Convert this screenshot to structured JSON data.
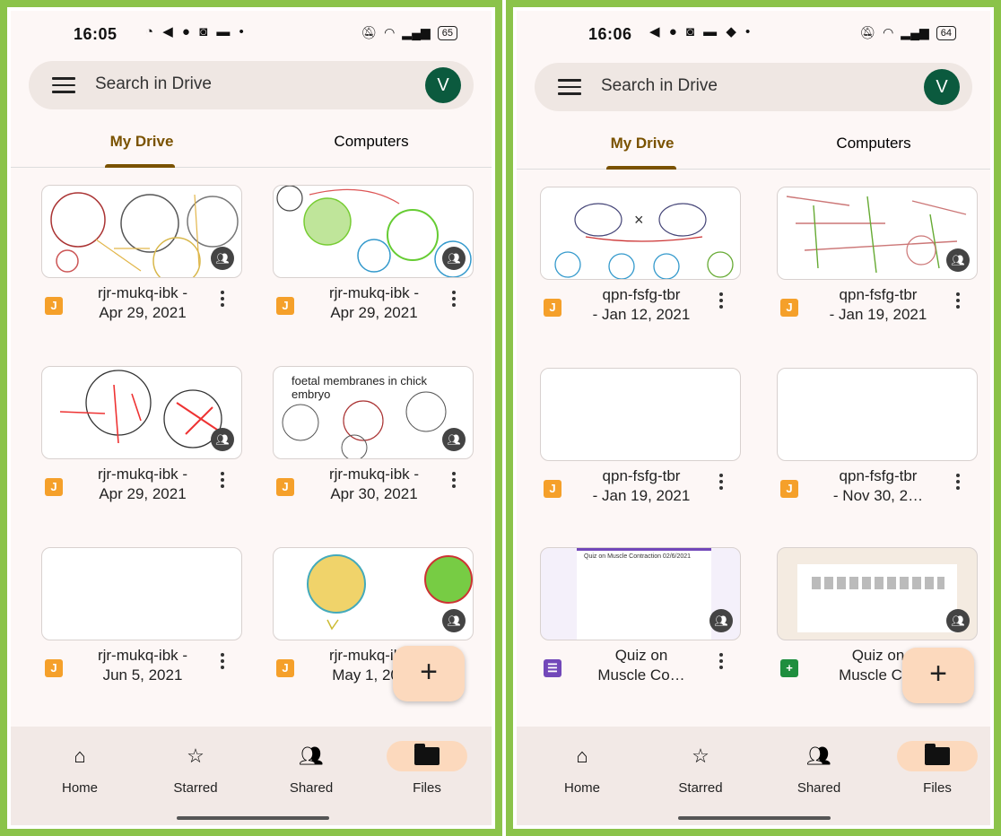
{
  "colors": {
    "accent": "#7a5200",
    "border": "#8bc34a",
    "avatar": "#0b5a3e",
    "fab": "#fcd9bd",
    "jamboard": "#f5a02a",
    "forms": "#7248b9",
    "sheets": "#1e8e3e"
  },
  "left": {
    "status": {
      "time": "16:05",
      "notifications": "◔ ◀ ● ◙ ▬ •",
      "battery": "65"
    },
    "search": {
      "placeholder": "Search in Drive",
      "avatar": "V"
    },
    "tabs": [
      "My Drive",
      "Computers"
    ],
    "files": [
      {
        "line1": "rjr-mukq-ibk -",
        "line2": "Apr 29, 2021",
        "icon": "jamboard-icon"
      },
      {
        "line1": "rjr-mukq-ibk -",
        "line2": "Apr 29, 2021",
        "icon": "jamboard-icon"
      },
      {
        "line1": "rjr-mukq-ibk -",
        "line2": "Apr 29, 2021",
        "icon": "jamboard-icon"
      },
      {
        "line1": "rjr-mukq-ibk -",
        "line2": "Apr 30, 2021",
        "icon": "jamboard-icon",
        "thumb_text": "foetal membranes in chick embryo"
      },
      {
        "line1": "rjr-mukq-ibk -",
        "line2": "Jun 5, 2021",
        "icon": "jamboard-icon"
      },
      {
        "line1": "rjr-mukq-ibk -",
        "line2": "May 1, 2021",
        "icon": "jamboard-icon"
      }
    ],
    "nav": [
      "Home",
      "Starred",
      "Shared",
      "Files"
    ]
  },
  "right": {
    "status": {
      "time": "16:06",
      "notifications": "◀ ● ◙ ▬ ◆ •",
      "battery": "64"
    },
    "search": {
      "placeholder": "Search in Drive",
      "avatar": "V"
    },
    "tabs": [
      "My Drive",
      "Computers"
    ],
    "files": [
      {
        "line1": "qpn-fsfg-tbr",
        "line2": "- Jan 12, 2021",
        "icon": "jamboard-icon"
      },
      {
        "line1": "qpn-fsfg-tbr",
        "line2": "- Jan 19, 2021",
        "icon": "jamboard-icon"
      },
      {
        "line1": "qpn-fsfg-tbr",
        "line2": "- Jan 19, 2021",
        "icon": "jamboard-icon"
      },
      {
        "line1": "qpn-fsfg-tbr",
        "line2": "- Nov 30, 2…",
        "icon": "jamboard-icon"
      },
      {
        "line1": "Quiz on",
        "line2": "Muscle Co…",
        "icon": "forms-icon",
        "thumb_text": "Quiz on Muscle Contraction 02/6/2021"
      },
      {
        "line1": "Quiz on",
        "line2": "Muscle C…",
        "icon": "sheets-icon"
      }
    ],
    "nav": [
      "Home",
      "Starred",
      "Shared",
      "Files"
    ]
  }
}
